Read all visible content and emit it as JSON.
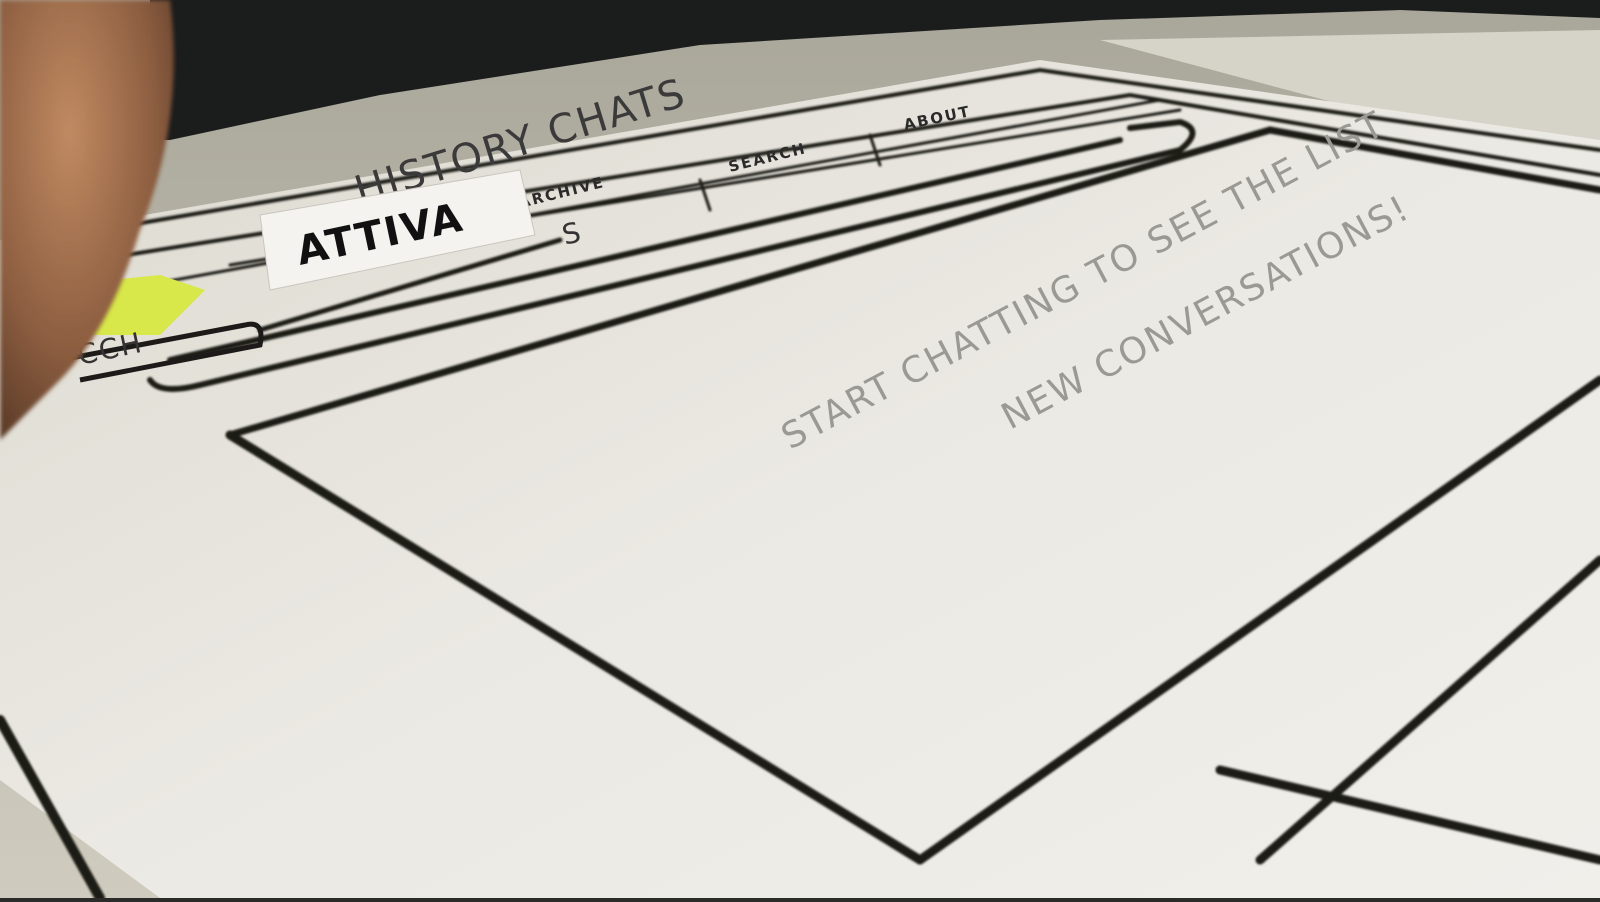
{
  "sketch": {
    "title": "HISTORY CHATS",
    "tabs": [
      "ARCHIVE",
      "SEARCH",
      "ABOUT"
    ],
    "sticky_note": "ATTIVA",
    "left_button": "CCH",
    "input_icon": "S",
    "message_line1": "START CHATTING TO SEE THE LIST",
    "message_line2": "NEW CONVERSATIONS!"
  },
  "colors": {
    "paper": "#e9e6dd",
    "ink": "#1c1b19",
    "sticky": "#d8e84a",
    "finger": "#b07a55",
    "desk": "#c9c6b9",
    "dark_object": "#1b1c1c"
  }
}
